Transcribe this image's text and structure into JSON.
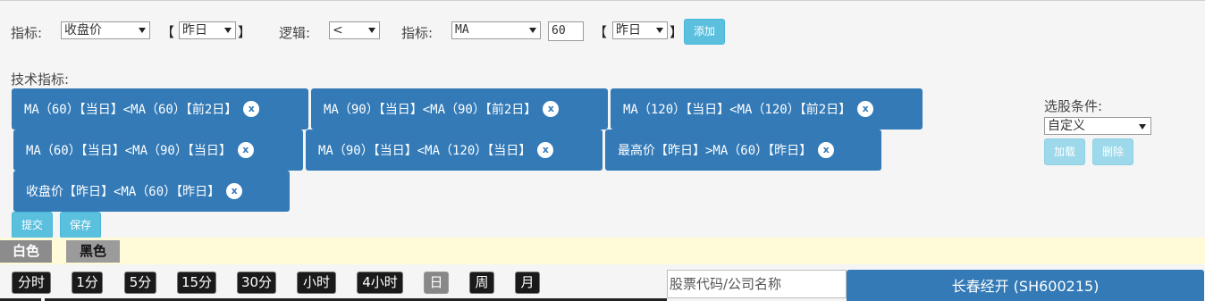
{
  "filter": {
    "indicator_label": "指标:",
    "indicator1_value": "收盘价",
    "bracket_open": "【",
    "day1_value": "昨日",
    "bracket_close": "】",
    "logic_label": "逻辑:",
    "logic_value": "<",
    "indicator2_label": "指标:",
    "indicator2_value": "MA",
    "period_value": "60",
    "day2_value": "昨日",
    "add_label": "添加"
  },
  "tech": {
    "title": "技术指标:",
    "conditions": [
      "MA（60）【当日】<MA（60）【前2日】",
      "MA（90）【当日】<MA（90）【前2日】",
      "MA（120）【当日】<MA（120）【前2日】",
      "MA（60）【当日】<MA（90）【当日】",
      "MA（90）【当日】<MA（120）【当日】",
      "最高价【昨日】>MA（60）【昨日】",
      "收盘价【昨日】<MA（60）【昨日】"
    ],
    "remove_glyph": "x",
    "submit_label": "提交",
    "save_label": "保存"
  },
  "side": {
    "title": "选股条件:",
    "select_value": "自定义",
    "load_label": "加载",
    "delete_label": "删除"
  },
  "theme": {
    "white_label": "白色",
    "black_label": "黑色"
  },
  "periods": [
    "分时",
    "1分",
    "5分",
    "15分",
    "30分",
    "小时",
    "4小时",
    "日",
    "周",
    "月"
  ],
  "active_period": "日",
  "search": {
    "placeholder": "股票代码/公司名称"
  },
  "stock": {
    "title": "长春经开 (SH600215)"
  },
  "colors": {
    "primary": "#337ab7",
    "info": "#5bc0de",
    "theme_bar": "#fffbd9"
  }
}
